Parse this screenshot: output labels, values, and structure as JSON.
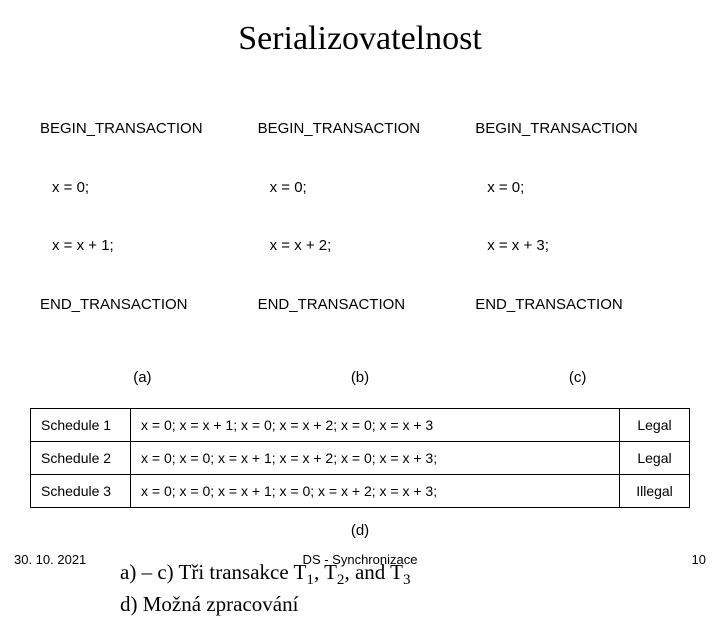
{
  "title": "Serializovatelnost",
  "transactions": {
    "a": {
      "begin": "BEGIN_TRANSACTION",
      "l1": "x = 0;",
      "l2": "x = x + 1;",
      "end": "END_TRANSACTION",
      "label": "(a)"
    },
    "b": {
      "begin": "BEGIN_TRANSACTION",
      "l1": "x = 0;",
      "l2": "x = x + 2;",
      "end": "END_TRANSACTION",
      "label": "(b)"
    },
    "c": {
      "begin": "BEGIN_TRANSACTION",
      "l1": "x = 0;",
      "l2": "x = x + 3;",
      "end": "END_TRANSACTION",
      "label": "(c)"
    }
  },
  "schedules": [
    {
      "name": "Schedule 1",
      "ops": "x = 0;  x = x + 1;  x = 0;  x = x + 2;  x = 0;  x = x + 3",
      "result": "Legal"
    },
    {
      "name": "Schedule 2",
      "ops": "x = 0;   x = 0;  x = x + 1;  x = x + 2;  x = 0;  x = x + 3;",
      "result": "Legal"
    },
    {
      "name": "Schedule 3",
      "ops": "x = 0;  x = 0;  x = x + 1;  x = 0;  x = x + 2;  x = x + 3;",
      "result": "Illegal"
    }
  ],
  "d_label": "(d)",
  "caption": {
    "line1_pre": "a) – c) Tři transakce T",
    "line1_mid1": ", T",
    "line1_mid2": ", and T",
    "line2": "d) Možná zpracování"
  },
  "footer": {
    "date": "30. 10. 2021",
    "mid": "DS - Synchronizace",
    "num": "10"
  }
}
